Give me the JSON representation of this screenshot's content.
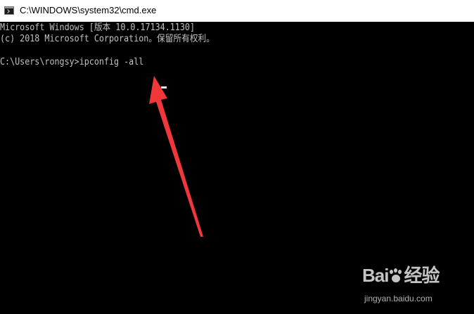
{
  "window": {
    "title": "C:\\WINDOWS\\system32\\cmd.exe",
    "icon": "cmd-icon"
  },
  "console": {
    "lines": [
      "Microsoft Windows [版本 10.0.17134.1130]",
      "(c) 2018 Microsoft Corporation。保留所有权利。",
      "",
      "C:\\Users\\rongsy>ipconfig -all"
    ],
    "text_color": "#c0c0c0",
    "background": "#000000"
  },
  "annotation": {
    "arrow_color": "#f0383a",
    "arrow_icon": "red-arrow-icon"
  },
  "watermark": {
    "logo_part1": "Bai",
    "logo_part2": "经验",
    "url": "jingyan.baidu.com"
  }
}
